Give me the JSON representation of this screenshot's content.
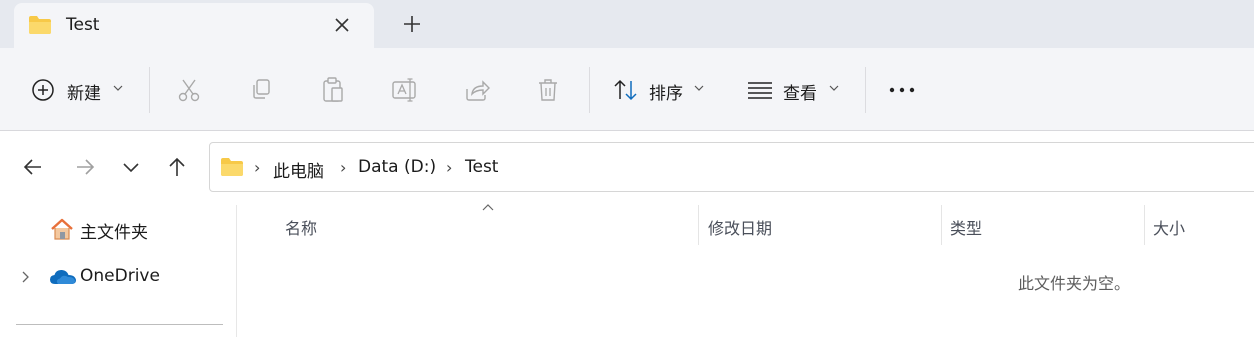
{
  "tab": {
    "title": "Test"
  },
  "commandbar": {
    "new_label": "新建",
    "sort_label": "排序",
    "view_label": "查看"
  },
  "breadcrumb": [
    "此电脑",
    "Data (D:)",
    "Test"
  ],
  "sidebar": {
    "items": [
      {
        "label": "主文件夹",
        "icon": "home-icon"
      },
      {
        "label": "OneDrive",
        "icon": "cloud-icon"
      }
    ]
  },
  "columns": [
    "名称",
    "修改日期",
    "类型",
    "大小"
  ],
  "empty_message": "此文件夹为空。",
  "colors": {
    "folder": "#f7c948",
    "accent": "#0f6cbd",
    "tabstrip": "#e6e9ef",
    "commandbar": "#f4f5f8"
  }
}
